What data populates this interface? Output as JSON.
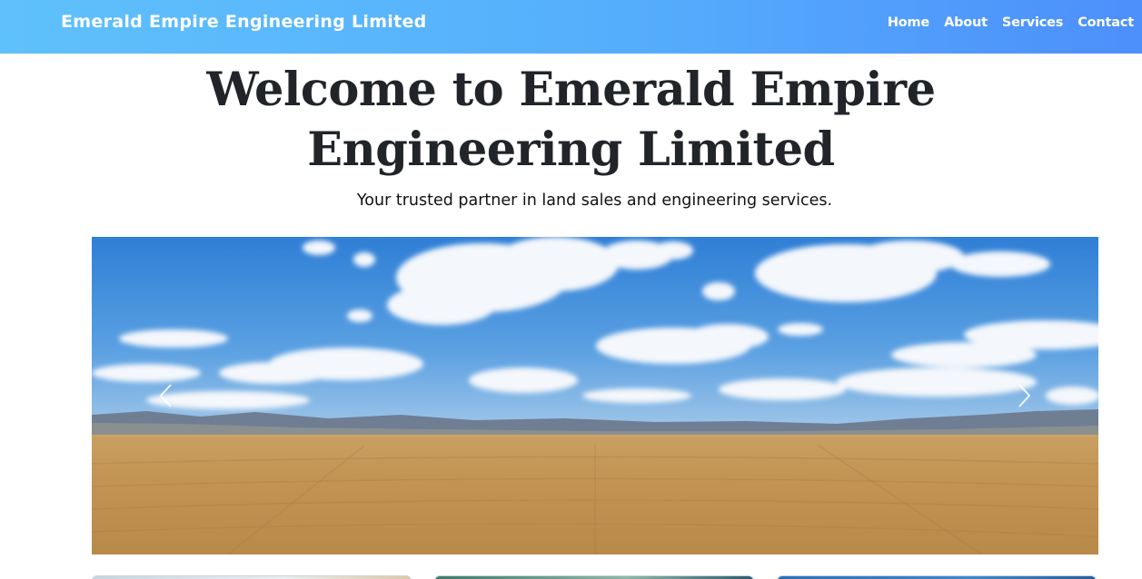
{
  "navbar": {
    "brand": "Emerald Empire Engineering Limited",
    "links": [
      "Home",
      "About",
      "Services",
      "Contact"
    ]
  },
  "hero": {
    "title_line1": "Welcome to Emerald Empire",
    "title_line2": "Engineering Limited",
    "subtitle": "Your trusted partner in land sales and engineering services."
  },
  "carousel": {
    "prev_icon": "chevron-left-icon",
    "next_icon": "chevron-right-icon"
  },
  "colors": {
    "nav_gradient_start": "#5fc1fb",
    "nav_gradient_end": "#4d8ffb",
    "heading": "#212529",
    "sky": "#3f86d6",
    "field": "#c79a58"
  }
}
